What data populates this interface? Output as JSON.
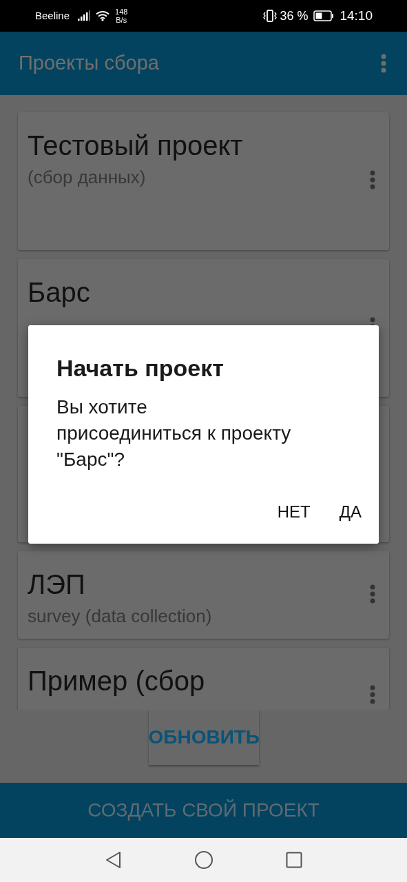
{
  "status_bar": {
    "carrier": "Beeline",
    "net_speed": [
      "148",
      "B/s"
    ],
    "battery": "36 %",
    "time": "14:10"
  },
  "app_bar": {
    "title": "Проекты сбора"
  },
  "projects": [
    {
      "kind": "project",
      "title": "Тестовый проект",
      "subtitle": "(сбор данных)"
    },
    {
      "kind": "project",
      "title": "Барс"
    },
    {
      "kind": "blank"
    },
    {
      "kind": "project",
      "title": "ЛЭП",
      "subtitle": "survey (data collection)"
    },
    {
      "kind": "project",
      "title": "Пример (сбор"
    }
  ],
  "refresh_button": "ОБНОВИТЬ",
  "create_button": "СОЗДАТЬ СВОЙ ПРОЕКТ",
  "dialog": {
    "title": "Начать проект",
    "message_lines": [
      "Вы хотите",
      "присоединиться к проекту",
      "\"Барс\"?"
    ],
    "buttons": [
      "НЕТ",
      "ДА"
    ]
  }
}
